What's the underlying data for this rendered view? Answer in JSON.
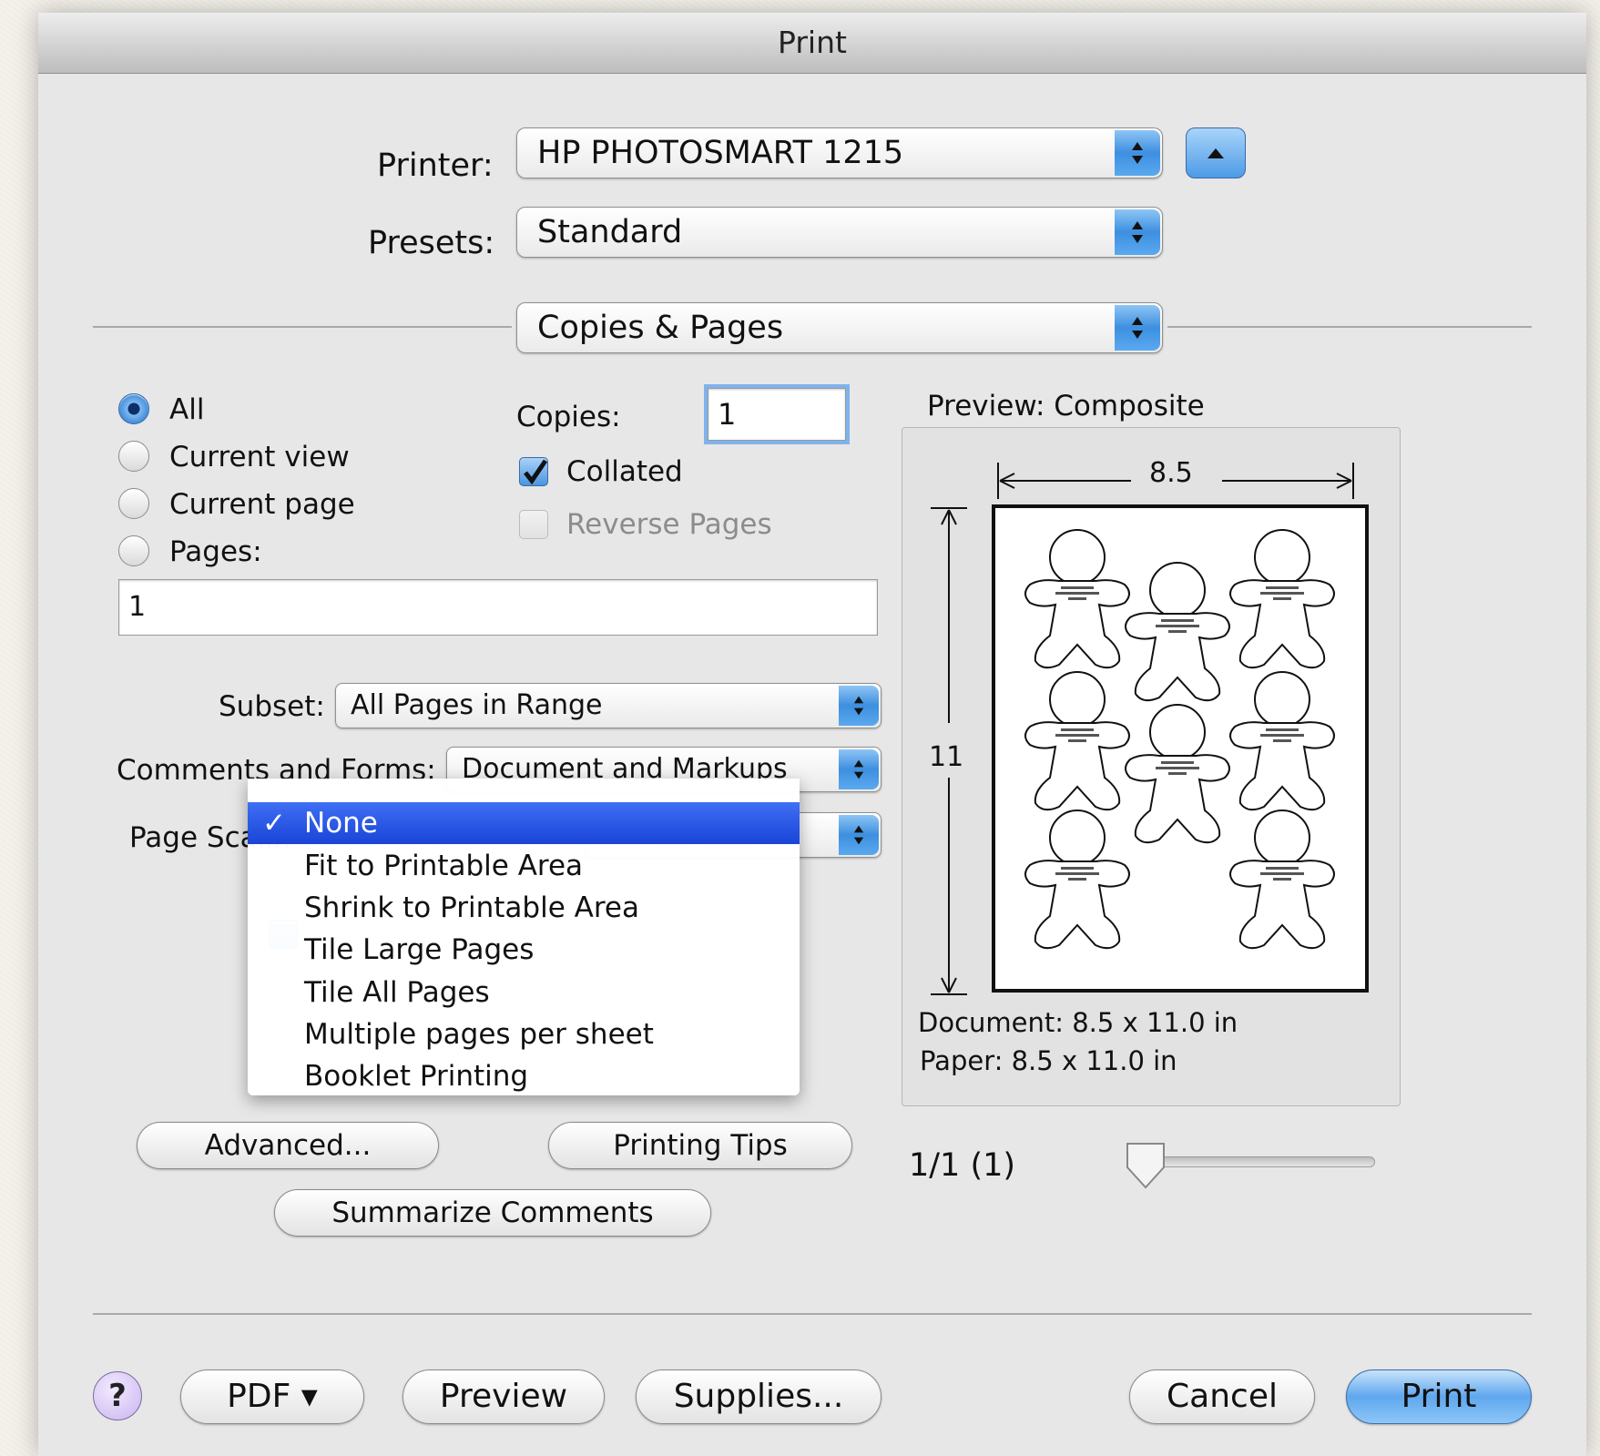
{
  "window": {
    "title": "Print"
  },
  "printer": {
    "label": "Printer:",
    "value": "HP PHOTOSMART 1215"
  },
  "presets": {
    "label": "Presets:",
    "value": "Standard"
  },
  "section": {
    "value": "Copies & Pages"
  },
  "range": {
    "options": [
      {
        "label": "All",
        "selected": true
      },
      {
        "label": "Current view",
        "selected": false
      },
      {
        "label": "Current page",
        "selected": false
      },
      {
        "label": "Pages:",
        "selected": false
      }
    ],
    "pages_value": "1"
  },
  "copies": {
    "label": "Copies:",
    "value": "1"
  },
  "collated": {
    "label": "Collated",
    "checked": true
  },
  "reverse_pages": {
    "label": "Reverse Pages",
    "checked": false,
    "enabled": false
  },
  "subset": {
    "label": "Subset:",
    "value": "All Pages in Range"
  },
  "comments_forms": {
    "label": "Comments and Forms:",
    "value": "Document and Markups"
  },
  "page_scaling": {
    "label": "Page Scalin",
    "menu": [
      {
        "label": "None",
        "selected": true,
        "check": "✓"
      },
      {
        "label": "Fit to Printable Area"
      },
      {
        "label": "Shrink to Printable Area"
      },
      {
        "label": "Tile Large Pages"
      },
      {
        "label": "Tile All Pages"
      },
      {
        "label": "Multiple pages per sheet"
      },
      {
        "label": "Booklet Printing"
      }
    ]
  },
  "buttons": {
    "advanced": "Advanced...",
    "printing_tips": "Printing Tips",
    "summarize_comments": "Summarize Comments",
    "help": "?",
    "pdf": "PDF ▾",
    "preview": "Preview",
    "supplies": "Supplies...",
    "cancel": "Cancel",
    "print": "Print"
  },
  "preview": {
    "title": "Preview: Composite",
    "width_label": "8.5",
    "height_label": "11",
    "document": "Document: 8.5 x 11.0 in",
    "paper": "Paper: 8.5 x 11.0 in",
    "page_counter": "1/1 (1)",
    "slider_value": 0
  },
  "colors": {
    "accent": "#3d8fe0",
    "menu_selection": "#2a55e6",
    "default_button": "#5fa7ee"
  },
  "icons": [
    "disclosure-up-icon",
    "popup-stepper-icon",
    "checkmark-icon",
    "help-icon"
  ]
}
